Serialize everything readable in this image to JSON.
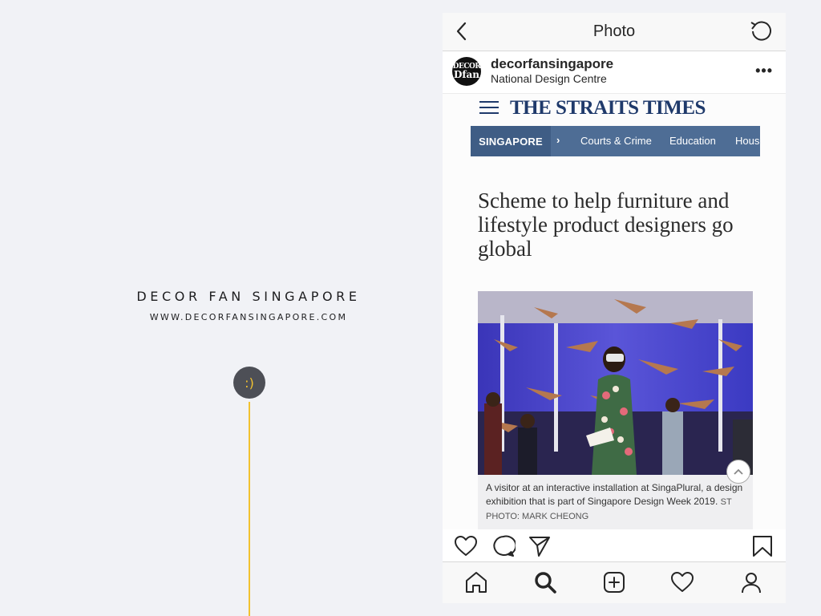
{
  "brand": {
    "title": "DECOR FAN SINGAPORE",
    "url": "WWW.DECORFANSINGAPORE.COM",
    "smiley": ":)",
    "accent_color": "#f2c230"
  },
  "topbar": {
    "title": "Photo",
    "back_icon": "chevron-left-icon",
    "refresh_icon": "refresh-icon"
  },
  "post": {
    "username": "decorfansingapore",
    "location": "National Design Centre",
    "avatar_text_top": "DECOR",
    "avatar_text_bottom": "Dfan",
    "more_label": "•••"
  },
  "article": {
    "masthead": "THE STRAITS TIMES",
    "section": "SINGAPORE",
    "nav_items": [
      "Courts & Crime",
      "Education",
      "Housi"
    ],
    "headline": "Scheme to help furniture and lifestyle product designers go global",
    "caption": "A visitor at an interactive installation at SingaPlural, a design exhibition that is part of Singapore Design Week 2019.",
    "credit": "ST PHOTO: MARK CHEONG",
    "brand_color": "#1f3a6b",
    "nav_color": "#4e6d95"
  },
  "actions": [
    "heart-icon",
    "comment-icon",
    "share-icon",
    "bookmark-icon"
  ],
  "tabs": [
    "home-icon",
    "search-icon",
    "add-post-icon",
    "activity-heart-icon",
    "profile-icon"
  ]
}
